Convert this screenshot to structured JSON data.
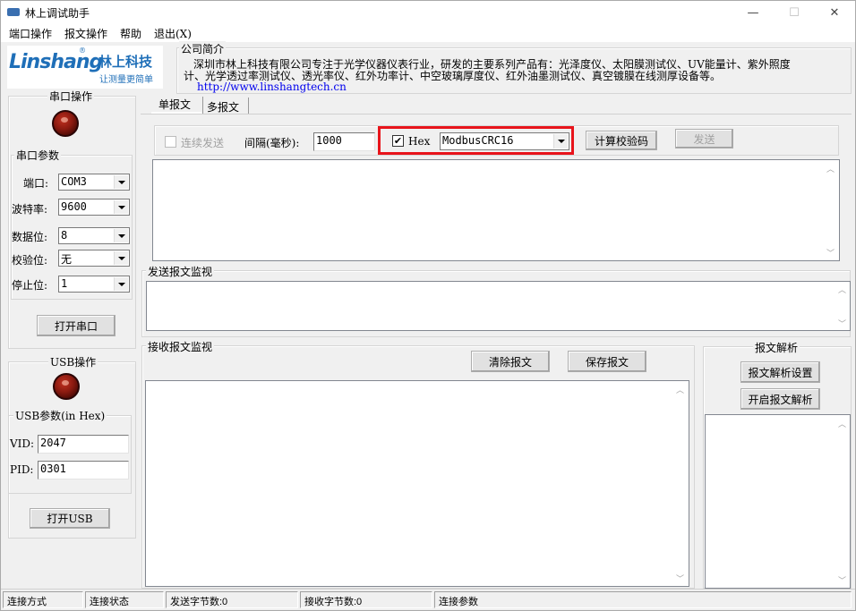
{
  "window": {
    "title": "林上调试助手",
    "minimize": "—",
    "maximize": "☐",
    "close": "✕"
  },
  "menu": {
    "items": [
      "端口操作",
      "报文操作",
      "帮助",
      "退出(X)"
    ]
  },
  "logo": {
    "brand": "Linshang",
    "registered": "®",
    "company_cn": "林上科技",
    "slogan": "让测量更简单"
  },
  "company": {
    "legend": "公司简介",
    "line1": "深圳市林上科技有限公司专注于光学仪器仪表行业，研发的主要系列产品有：光泽度仪、太阳膜测试仪、UV能量计、紫外照度",
    "line2": "计、光学透过率测试仪、透光率仪、红外功率计、中空玻璃厚度仪、红外油墨测试仪、真空镀膜在线测厚设备等。",
    "url": "http://www.linshangtech.cn"
  },
  "serial": {
    "legend": "串口操作",
    "params_legend": "串口参数",
    "port_label": "端口:",
    "port_value": "COM3",
    "baud_label": "波特率:",
    "baud_value": "9600",
    "databits_label": "数据位:",
    "databits_value": "8",
    "parity_label": "校验位:",
    "parity_value": "无",
    "stopbits_label": "停止位:",
    "stopbits_value": "1",
    "open_button": "打开串口"
  },
  "usb": {
    "legend": "USB操作",
    "params_legend": "USB参数(in Hex)",
    "vid_label": "VID:",
    "vid_value": "2047",
    "pid_label": "PID:",
    "pid_value": "0301",
    "open_button": "打开USB"
  },
  "tabs": {
    "single": "单报文",
    "multi": "多报文"
  },
  "send_controls": {
    "continuous_label": "连续发送",
    "interval_label": "间隔(毫秒):",
    "interval_value": "1000",
    "hex_label": "Hex",
    "hex_checked": true,
    "checksum_value": "ModbusCRC16",
    "calc_button": "计算校验码",
    "send_button": "发送"
  },
  "send_monitor": {
    "legend": "发送报文监视"
  },
  "receive_monitor": {
    "legend": "接收报文监视",
    "clear_button": "清除报文",
    "save_button": "保存报文"
  },
  "parse": {
    "legend": "报文解析",
    "settings_button": "报文解析设置",
    "open_button": "开启报文解析"
  },
  "status": {
    "conn_mode": "连接方式",
    "conn_state": "连接状态",
    "sent_bytes": "发送字节数:0",
    "recv_bytes": "接收字节数:0",
    "conn_params": "连接参数"
  },
  "colors": {
    "highlight": "#e8141b",
    "logo_blue": "#1f6fb8"
  }
}
